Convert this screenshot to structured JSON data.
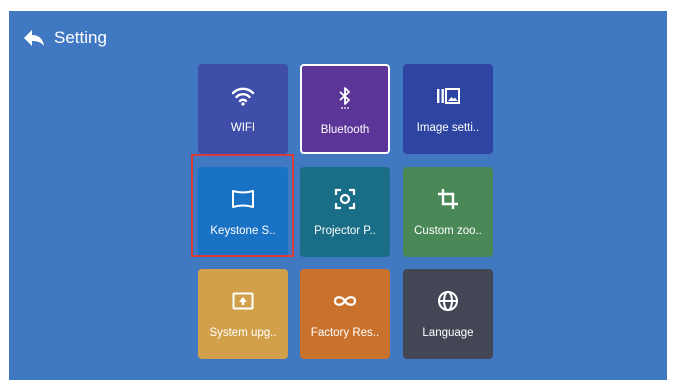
{
  "header": {
    "back_icon": "back-arrow-icon",
    "title": "Setting"
  },
  "tiles": [
    {
      "label": "WIFI",
      "icon": "wifi-icon",
      "color": "#3f4fa9"
    },
    {
      "label": "Bluetooth",
      "icon": "bluetooth-icon",
      "color": "#5b3597",
      "selected": true
    },
    {
      "label": "Image setti..",
      "icon": "image-settings-icon",
      "color": "#2d45a0"
    },
    {
      "label": "Keystone S..",
      "icon": "keystone-icon",
      "color": "#1a72c5",
      "focused": true
    },
    {
      "label": "Projector P..",
      "icon": "projector-position-icon",
      "color": "#1a6d86"
    },
    {
      "label": "Custom zoo..",
      "icon": "crop-icon",
      "color": "#4b8858"
    },
    {
      "label": "System upg..",
      "icon": "system-upgrade-icon",
      "color": "#d2a04b"
    },
    {
      "label": "Factory Res..",
      "icon": "infinity-icon",
      "color": "#c8722e"
    },
    {
      "label": "Language",
      "icon": "globe-icon",
      "color": "#434755"
    }
  ],
  "colors": {
    "screen_background": "#4178c2",
    "focus_border": "#d93a3a",
    "selected_border": "#ffffff"
  }
}
